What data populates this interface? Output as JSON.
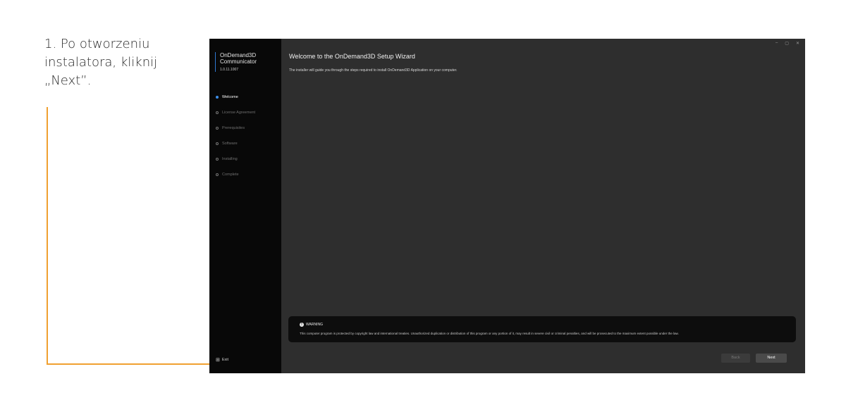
{
  "instruction": {
    "text": "1. Po otworzeniu\ninstalatora, kliknij\n„Next”."
  },
  "window": {
    "controls": {
      "minimize": "–",
      "maximize": "▢",
      "close": "✕"
    }
  },
  "sidebar": {
    "brand_title": "OnDemand3D\nCommunicator",
    "brand_version": "1.0.11.1007",
    "steps": [
      {
        "label": "Welcome",
        "active": true
      },
      {
        "label": "License Agreement",
        "active": false
      },
      {
        "label": "Prerequisites",
        "active": false
      },
      {
        "label": "Software",
        "active": false
      },
      {
        "label": "Installing",
        "active": false
      },
      {
        "label": "Complete",
        "active": false
      }
    ],
    "exit_icon": "⊞",
    "exit_label": "Exit"
  },
  "main": {
    "title": "Welcome to the OnDemand3D Setup Wizard",
    "subtitle": "The installer will guide you through the steps required to install OnDemand3D Application on your computer."
  },
  "warning": {
    "icon": "!",
    "heading": "WARNING",
    "text": "This computer program is protected by copyright law and international treaties. Unauthorized duplication or distribution of this program or any portion of it, may result in severe civil or criminal penalties, and will be prosecuted to the maximum extent possible under the law."
  },
  "buttons": {
    "back": "Back",
    "next": "Next"
  },
  "colors": {
    "accent": "#3d8ee8",
    "annotation": "#f0a030"
  }
}
